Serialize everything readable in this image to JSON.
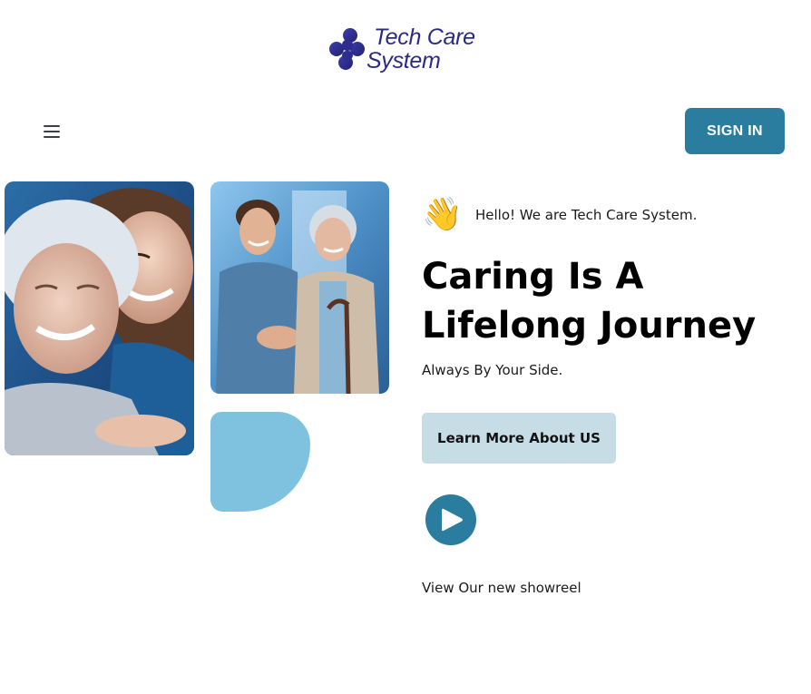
{
  "brand": {
    "line1": "Tech Care",
    "line2": "System",
    "color": "#2a2a86"
  },
  "header": {
    "menu_icon": "hamburger-icon",
    "signin_label": "SIGN IN"
  },
  "hero": {
    "wave_emoji": "👋",
    "greeting": "Hello! We are Tech Care System.",
    "headline": "Caring Is A Lifelong Journey",
    "tagline": "Always By Your Side.",
    "cta_label": "Learn More About US",
    "play_icon": "play-icon",
    "showreel_label": "View Our new showreel"
  },
  "colors": {
    "accent": "#2a7d9e",
    "cta_bg": "#c7dde6",
    "blob": "#7fc2df"
  }
}
